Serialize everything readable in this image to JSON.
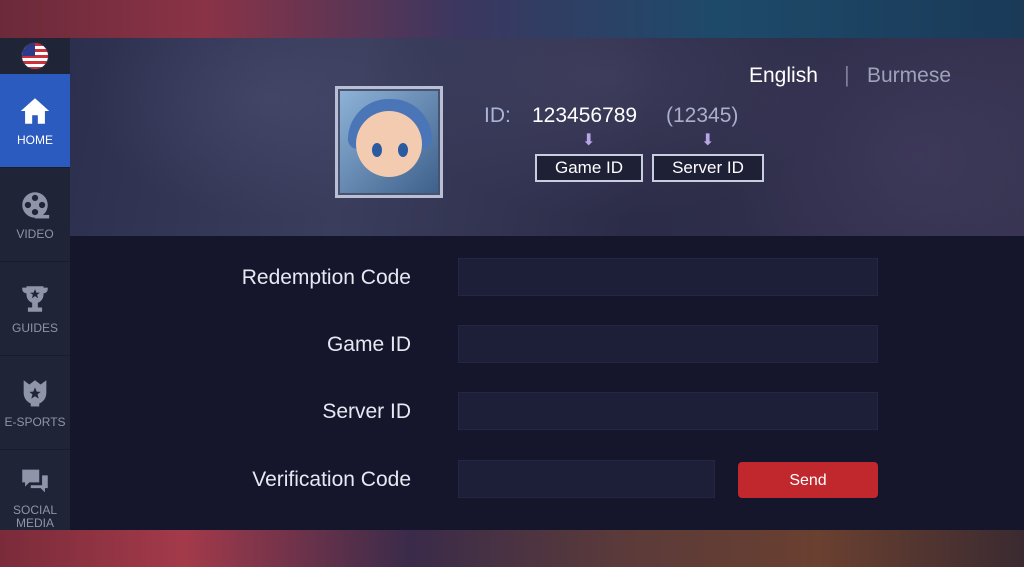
{
  "sidebar": {
    "flag_icon": "us-flag-icon",
    "items": [
      {
        "label": "HOME",
        "icon": "home-icon",
        "active": true
      },
      {
        "label": "VIDEO",
        "icon": "film-reel-icon",
        "active": false
      },
      {
        "label": "GUIDES",
        "icon": "trophy-icon",
        "active": false
      },
      {
        "label": "E-SPORTS",
        "icon": "esports-emblem-icon",
        "active": false
      },
      {
        "label": "SOCIAL MEDIA",
        "icon": "chat-bubbles-icon",
        "active": false
      }
    ]
  },
  "header": {
    "languages": {
      "english": "English",
      "separator": "|",
      "burmese": "Burmese"
    },
    "id_label": "ID:",
    "id_value": "123456789",
    "server_value": "(12345)",
    "game_id_box": "Game ID",
    "server_id_box": "Server ID",
    "arrow_glyph": "⬇"
  },
  "form": {
    "redemption_code_label": "Redemption Code",
    "game_id_label": "Game ID",
    "server_id_label": "Server ID",
    "verification_code_label": "Verification Code",
    "redemption_code_value": "",
    "game_id_value": "",
    "server_id_value": "",
    "verification_code_value": "",
    "send_label": "Send"
  },
  "colors": {
    "active_nav": "#2c5bbf",
    "send_button": "#c0282e",
    "panel_bg": "#15162c",
    "input_bg": "#1d1f38"
  }
}
